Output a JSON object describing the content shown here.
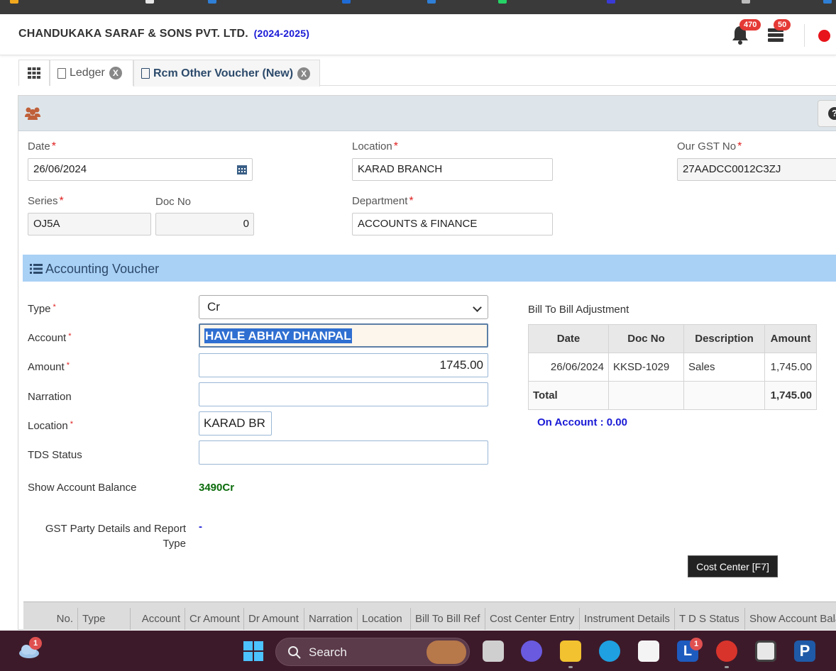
{
  "header": {
    "company": "CHANDUKAKA SARAF & SONS PVT. LTD.",
    "fy": "(2024-2025)",
    "notif_count": "470",
    "task_count": "50"
  },
  "tabs": [
    {
      "label": "Ledger",
      "close": "X"
    },
    {
      "label": "Rcm Other Voucher (New)",
      "close": "X"
    }
  ],
  "form": {
    "date_label": "Date",
    "date_value": "26/06/2024",
    "location_label": "Location",
    "location_value": "KARAD BRANCH",
    "gst_label": "Our GST No",
    "gst_value": "27AADCC0012C3ZJ",
    "series_label": "Series",
    "series_value": "OJ5A",
    "docno_label": "Doc No",
    "docno_value": "0",
    "department_label": "Department",
    "department_value": "ACCOUNTS & FINANCE",
    "required_mark": "*"
  },
  "voucher": {
    "section_title": "Accounting Voucher",
    "type_label": "Type",
    "type_value": "Cr",
    "account_label": "Account",
    "account_value": "HAVLE ABHAY DHANPAL",
    "amount_label": "Amount",
    "amount_value": "1745.00",
    "narration_label": "Narration",
    "narration_value": "",
    "location_label": "Location",
    "location_value": "KARAD BR",
    "tds_label": "TDS Status",
    "tds_value": "",
    "balance_label": "Show Account Balance",
    "balance_value": "3490Cr",
    "gst_party_label": "GST Party Details and Report Type",
    "gst_party_value": "-",
    "required_mark": "*"
  },
  "bill_adjust": {
    "title": "Bill To Bill Adjustment",
    "columns": [
      "Date",
      "Doc No",
      "Description",
      "Amount"
    ],
    "rows": [
      {
        "date": "26/06/2024",
        "doc_no": "KKSD-1029",
        "description": "Sales",
        "amount": "1,745.00"
      }
    ],
    "total_label": "Total",
    "total_amount": "1,745.00",
    "on_account": "On Account : 0.00"
  },
  "tooltip": "Cost Center [F7]",
  "grid": {
    "columns": [
      "No.",
      "Type",
      "Account",
      "Cr Amount",
      "Dr Amount",
      "Narration",
      "Location",
      "Bill To Bill Ref",
      "Cost Center Entry",
      "Instrument Details",
      "T D S Status",
      "Show Account Bala"
    ]
  },
  "taskbar": {
    "search_placeholder": "Search",
    "weather_badge": "1",
    "l_badge": "1"
  },
  "colors": {
    "accent": "#1a1ad6",
    "section_bar": "#a9d0f5",
    "balance": "#0a6b0a",
    "on_account": "#1a1ad6",
    "required": "#e02020"
  }
}
